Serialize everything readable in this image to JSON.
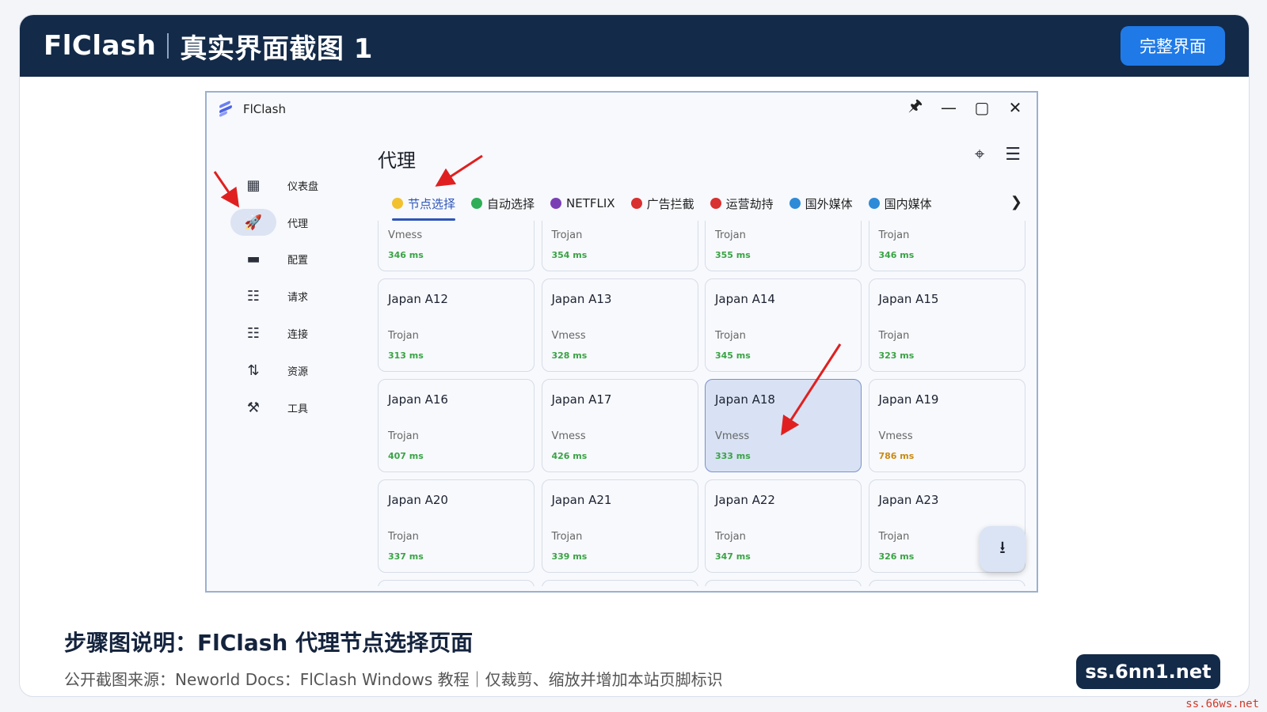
{
  "header": {
    "app": "FlClash",
    "title": "真实界面截图 1",
    "button": "完整界面"
  },
  "window": {
    "title": "FlClash"
  },
  "sidebar": {
    "items": [
      {
        "label": "仪表盘",
        "icon": "dashboard-icon"
      },
      {
        "label": "代理",
        "icon": "rocket-icon",
        "active": true
      },
      {
        "label": "配置",
        "icon": "folder-icon"
      },
      {
        "label": "请求",
        "icon": "request-icon"
      },
      {
        "label": "连接",
        "icon": "connections-icon"
      },
      {
        "label": "资源",
        "icon": "resources-icon"
      },
      {
        "label": "工具",
        "icon": "tools-icon"
      }
    ]
  },
  "page": {
    "title": "代理"
  },
  "tabs": [
    {
      "label": "节点选择",
      "color": "#f2c12e",
      "active": true
    },
    {
      "label": "自动选择",
      "color": "#2fae57"
    },
    {
      "label": "NETFLIX",
      "color": "#7b3fb5"
    },
    {
      "label": "广告拦截",
      "color": "#d93030"
    },
    {
      "label": "运营劫持",
      "color": "#d93030"
    },
    {
      "label": "国外媒体",
      "color": "#2e8bd8"
    },
    {
      "label": "国内媒体",
      "color": "#2e8bd8"
    }
  ],
  "cards": [
    {
      "name": "",
      "type": "Vmess",
      "latency": "346 ms",
      "color": "#3aa345"
    },
    {
      "name": "",
      "type": "Trojan",
      "latency": "354 ms",
      "color": "#3aa345"
    },
    {
      "name": "",
      "type": "Trojan",
      "latency": "355 ms",
      "color": "#3aa345"
    },
    {
      "name": "",
      "type": "Trojan",
      "latency": "346 ms",
      "color": "#3aa345"
    },
    {
      "name": "Japan A12",
      "type": "Trojan",
      "latency": "313 ms",
      "color": "#3aa345"
    },
    {
      "name": "Japan A13",
      "type": "Vmess",
      "latency": "328 ms",
      "color": "#3aa345"
    },
    {
      "name": "Japan A14",
      "type": "Trojan",
      "latency": "345 ms",
      "color": "#3aa345"
    },
    {
      "name": "Japan A15",
      "type": "Trojan",
      "latency": "323 ms",
      "color": "#3aa345"
    },
    {
      "name": "Japan A16",
      "type": "Trojan",
      "latency": "407 ms",
      "color": "#3aa345"
    },
    {
      "name": "Japan A17",
      "type": "Vmess",
      "latency": "426 ms",
      "color": "#3aa345"
    },
    {
      "name": "Japan A18",
      "type": "Vmess",
      "latency": "333 ms",
      "color": "#3aa345",
      "selected": true
    },
    {
      "name": "Japan A19",
      "type": "Vmess",
      "latency": "786 ms",
      "color": "#c98a12"
    },
    {
      "name": "Japan A20",
      "type": "Trojan",
      "latency": "337 ms",
      "color": "#3aa345"
    },
    {
      "name": "Japan A21",
      "type": "Trojan",
      "latency": "339 ms",
      "color": "#3aa345"
    },
    {
      "name": "Japan A22",
      "type": "Trojan",
      "latency": "347 ms",
      "color": "#3aa345"
    },
    {
      "name": "Japan A23",
      "type": "Trojan",
      "latency": "326 ms",
      "color": "#3aa345"
    }
  ],
  "caption": {
    "title": "步骤图说明：FlClash 代理节点选择页面",
    "source": "公开截图来源：Neworld Docs：FlClash Windows 教程｜仅裁剪、缩放并增加本站页脚标识"
  },
  "site": "ss.6nn1.net",
  "watermark": "ss.66ws.net"
}
